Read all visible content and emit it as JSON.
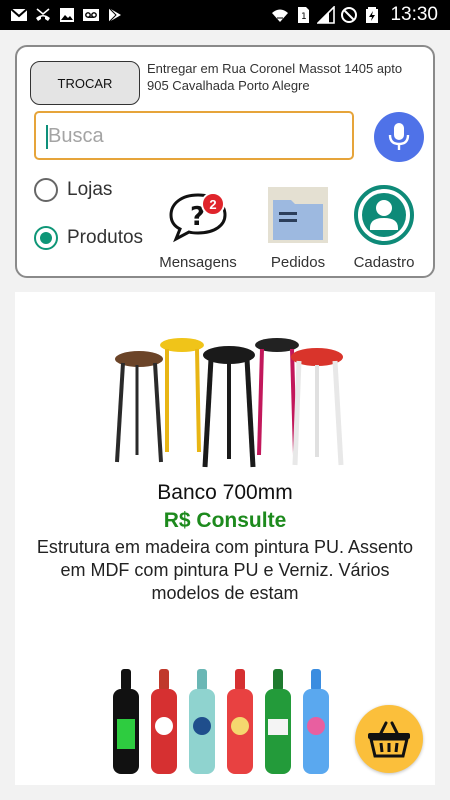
{
  "status_bar": {
    "time": "13:30",
    "notification_icons": [
      "gmail-icon",
      "missed-call-icon",
      "image-icon",
      "voicemail-icon",
      "play-store-icon"
    ],
    "system_icons": [
      "wifi-icon",
      "sim-icon",
      "signal-icon",
      "do-not-disturb-icon",
      "battery-icon"
    ]
  },
  "header": {
    "change_button_label": "TROCAR",
    "address": "Entregar em Rua Coronel Massot 1405 apto 905 Cavalhada Porto Alegre",
    "search": {
      "placeholder": "Busca",
      "value": ""
    },
    "search_type_options": [
      {
        "label": "Lojas",
        "selected": false
      },
      {
        "label": "Produtos",
        "selected": true
      }
    ],
    "menu": {
      "messages": {
        "label": "Mensagens",
        "badge": "2"
      },
      "orders": {
        "label": "Pedidos"
      },
      "profile": {
        "label": "Cadastro"
      }
    }
  },
  "products": [
    {
      "name": "Banco 700mm",
      "price": "R$ Consulte",
      "description": "Estrutura em madeira com pintura PU. Assento em MDF com pintura PU e Verniz. Vários modelos de estam",
      "image": "stools-photo"
    },
    {
      "image": "bottle-cover-photo"
    }
  ],
  "colors": {
    "accent": "#0e9677",
    "price": "#1d8a1d",
    "search_border": "#e6a43a",
    "mic": "#4f72e8",
    "badge": "#e0242b",
    "fab": "#fbbf3b"
  }
}
